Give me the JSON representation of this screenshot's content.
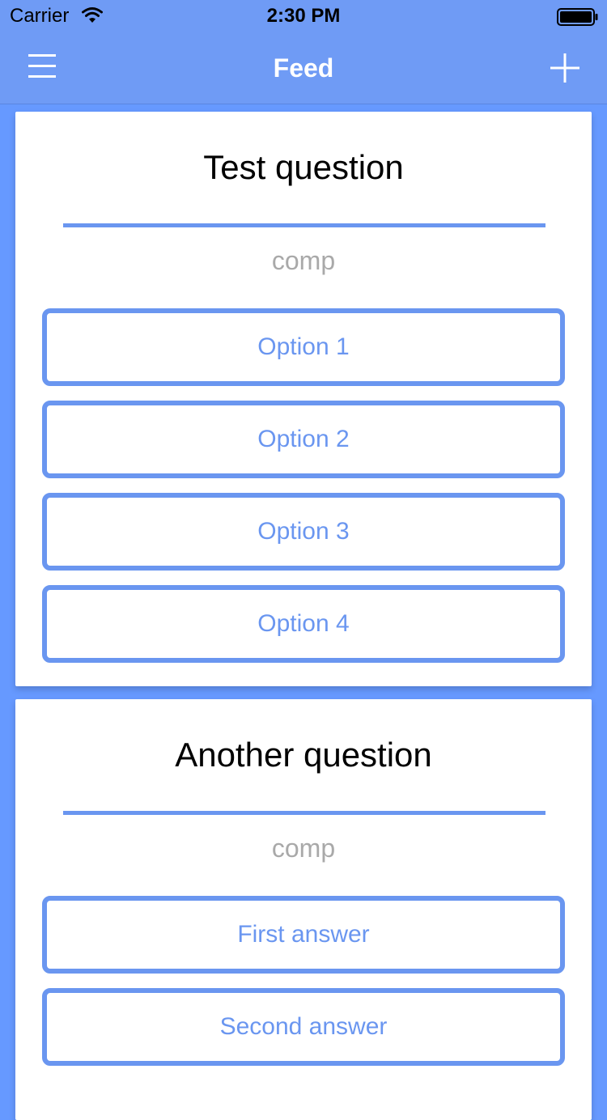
{
  "status_bar": {
    "carrier": "Carrier",
    "time": "2:30 PM",
    "wifi_icon": "wifi-icon",
    "battery_icon": "battery-icon"
  },
  "nav": {
    "title": "Feed",
    "menu_icon": "hamburger-menu-icon",
    "add_icon": "plus-icon"
  },
  "colors": {
    "background": "#6699ff",
    "nav_bar": "#6f9bf5",
    "accent": "#6a96f0",
    "subtitle_text": "#a9a9a9",
    "card": "#ffffff"
  },
  "questions": [
    {
      "title": "Test question",
      "subtitle": "comp",
      "options": [
        "Option 1",
        "Option 2",
        "Option 3",
        "Option 4"
      ]
    },
    {
      "title": "Another question",
      "subtitle": "comp",
      "options": [
        "First answer",
        "Second answer"
      ]
    }
  ]
}
